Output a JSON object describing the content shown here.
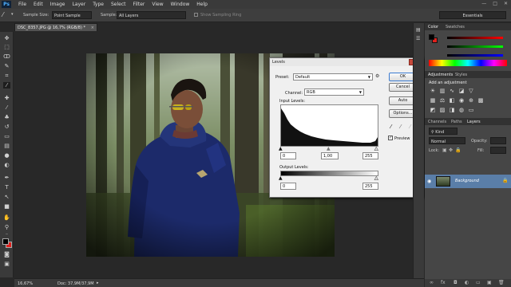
{
  "app": {
    "logo": "Ps"
  },
  "menu": [
    "File",
    "Edit",
    "Image",
    "Layer",
    "Type",
    "Select",
    "Filter",
    "View",
    "Window",
    "Help"
  ],
  "window_controls": [
    "—",
    "□",
    "✕"
  ],
  "options_bar": {
    "sample_size_label": "Sample Size:",
    "sample_size_value": "Point Sample",
    "sample_label": "Sample:",
    "sample_value": "All Layers",
    "show_ring_label": "Show Sampling Ring",
    "workspace": "Essentials"
  },
  "document": {
    "tab_title": "DSC_8357.JPG @ 16,7% (RGB/8) *",
    "tab_close": "×"
  },
  "status": {
    "zoom": "16,67%",
    "doc_info": "Doc: 37,9M/37,9M"
  },
  "levels": {
    "title": "Levels",
    "close": "x",
    "preset_label": "Preset:",
    "preset_value": "Default",
    "channel_label": "Channel:",
    "channel_value": "RGB",
    "input_levels_label": "Input Levels:",
    "input_black": "0",
    "input_gamma": "1,00",
    "input_white": "255",
    "output_levels_label": "Output Levels:",
    "output_black": "0",
    "output_white": "255",
    "buttons": {
      "ok": "OK",
      "cancel": "Cancel",
      "auto": "Auto",
      "options": "Options..."
    },
    "preview_label": "Preview",
    "preview_checked": true
  },
  "panels": {
    "color_tabs": [
      "Color",
      "Swatches"
    ],
    "adjust_tabs": [
      "Adjustments",
      "Styles"
    ],
    "adjust_title": "Add an adjustment",
    "layer_tabs": [
      "Channels",
      "Paths",
      "Layers"
    ],
    "kind_label": "Kind",
    "blend_mode": "Normal",
    "opacity_label": "Opacity:",
    "lock_label": "Lock:",
    "fill_label": "Fill:",
    "layer_name": "Background"
  },
  "colors": {
    "foreground": "#000000",
    "background": "#e0201c",
    "accent": "#5a7ea8"
  }
}
